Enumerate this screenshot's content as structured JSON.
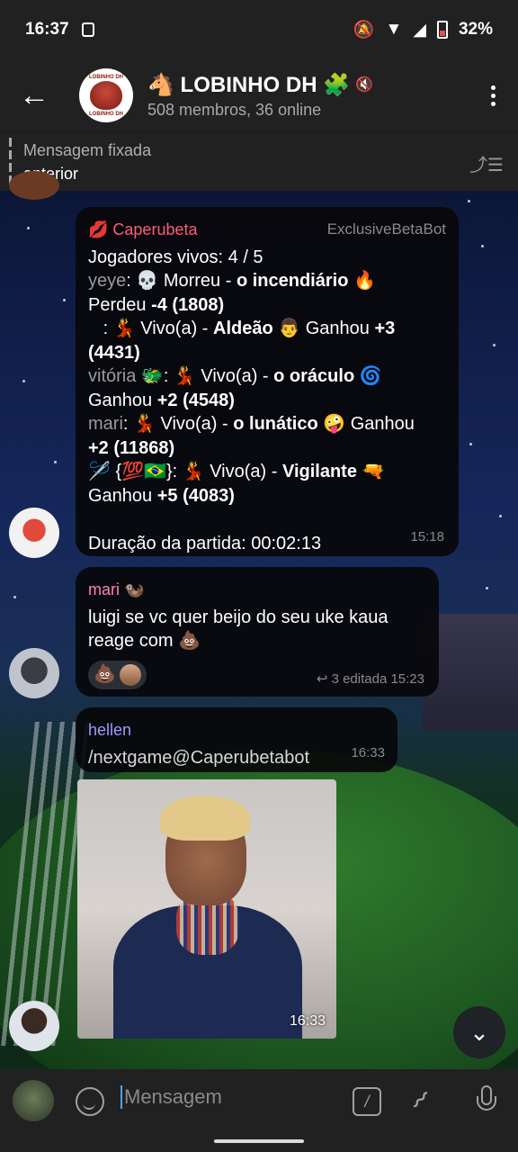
{
  "status_bar": {
    "time": "16:37",
    "battery": "32%"
  },
  "header": {
    "title": "🐴 LOBINHO DH 🧩",
    "subtitle": "508 membros, 36 online",
    "avatar_text_top": "LOBINHO DH",
    "avatar_text_bottom": "LOBINHO DH"
  },
  "pinned": {
    "label": "Mensagem fixada",
    "text": "anterior"
  },
  "messages": {
    "bot": {
      "sender": "💋 Caperubeta",
      "via": "ExclusiveBetaBot",
      "lines": {
        "l1": "Jogadores vivos: 4 / 5",
        "l2_name": "yeye",
        "l2_rest": ": 💀 Morreu - ",
        "l2_role": "o incendiário",
        "l2_emoji": " 🔥",
        "l3_a": "Perdeu ",
        "l3_b": "-4 (1808)",
        "l4_a": "   : 💃 Vivo(a) - ",
        "l4_role": "Aldeão",
        "l4_b": " 👨 Ganhou ",
        "l4_c": "+3",
        "l5": "(4431)",
        "l6_name": "vitória 🐲",
        "l6_rest": ": 💃 Vivo(a) - ",
        "l6_role": "o oráculo",
        "l6_emoji": " 🌀",
        "l7_a": "Ganhou ",
        "l7_b": "+2 (4548)",
        "l8_name": "mari",
        "l8_rest": ": 💃 Vivo(a) - ",
        "l8_role": "o lunático",
        "l8_b": " 🤪 Ganhou",
        "l9": "+2 (11868)",
        "l10_a": "🪡 {💯🇧🇷}: 💃 Vivo(a) - ",
        "l10_role": "Vigilante",
        "l10_emoji": " 🔫",
        "l11_a": "Ganhou ",
        "l11_b": "+5 (4083)",
        "l12": "Duração da partida: 00:02:13"
      },
      "time": "15:18"
    },
    "mari": {
      "sender": "mari 🦦",
      "text": "luigi se vc quer beijo do seu uke kaua reage com 💩",
      "reaction_emoji": "💩",
      "reply_count": "3",
      "edited": "editada 15:23"
    },
    "hellen": {
      "sender": "hellen",
      "text": "/nextgame@Caperubetabot",
      "time": "16:33"
    },
    "photo": {
      "time": "16:33"
    }
  },
  "input": {
    "placeholder": "Mensagem"
  },
  "icons": {
    "back": "arrow-left-icon",
    "menu": "more-vertical-icon",
    "pin": "pin-list-icon",
    "scroll": "chevron-down-icon",
    "emoji": "smile-icon",
    "command": "slash-command-icon",
    "attach": "paperclip-icon",
    "mic": "microphone-icon"
  }
}
